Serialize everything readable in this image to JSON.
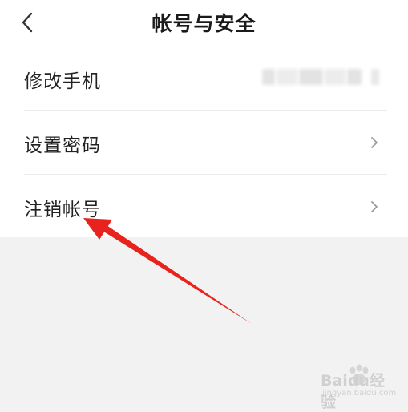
{
  "header": {
    "title": "帐号与安全",
    "back_icon": "chevron-left-icon"
  },
  "settings": {
    "items": [
      {
        "label": "修改手机",
        "value_hidden": true
      },
      {
        "label": "设置密码",
        "icon": "chevron-right-icon"
      },
      {
        "label": "注销帐号",
        "icon": "chevron-right-icon"
      }
    ]
  },
  "annotation": {
    "color": "#e8231d",
    "icon": "red-arrow-icon"
  },
  "watermark": {
    "text": "Baidu经验",
    "sub": "jingyan.baidu.com"
  },
  "colors": {
    "background": "#f2f2f2",
    "surface": "#ffffff",
    "text": "#222222",
    "divider": "#ececec",
    "chevron": "#9a9a9a"
  }
}
